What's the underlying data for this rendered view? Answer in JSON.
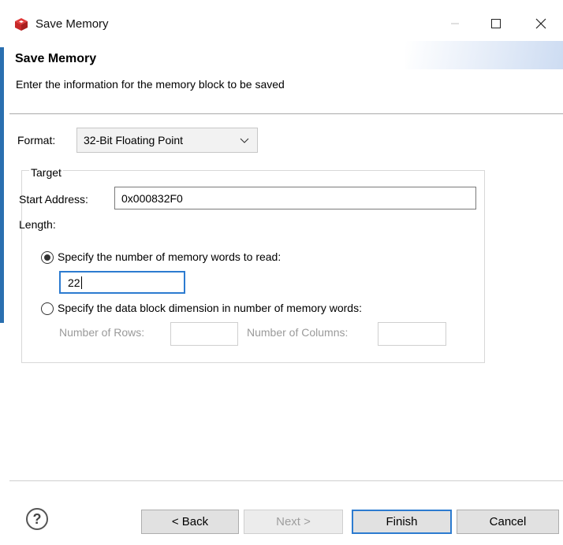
{
  "window": {
    "title": "Save Memory",
    "icon": "cube-icon"
  },
  "header": {
    "title": "Save Memory",
    "description": "Enter the information for the memory block to be saved"
  },
  "format": {
    "label": "Format:",
    "selected": "32-Bit Floating Point"
  },
  "target": {
    "legend": "Target",
    "start_address_label": "Start Address:",
    "start_address_value": "0x000832F0",
    "length_label": "Length:",
    "option_words_label": "Specify the number of memory words to read:",
    "option_words_selected": true,
    "words_value": "22",
    "option_block_label": "Specify the data block dimension in number of memory words:",
    "option_block_selected": false,
    "rows_label": "Number of Rows:",
    "rows_value": "",
    "columns_label": "Number of Columns:",
    "columns_value": ""
  },
  "footer": {
    "help": "?",
    "back": "< Back",
    "next": "Next >",
    "finish": "Finish",
    "cancel": "Cancel"
  },
  "colors": {
    "accent": "#2c7bd0",
    "icon_red": "#d62b2b"
  }
}
